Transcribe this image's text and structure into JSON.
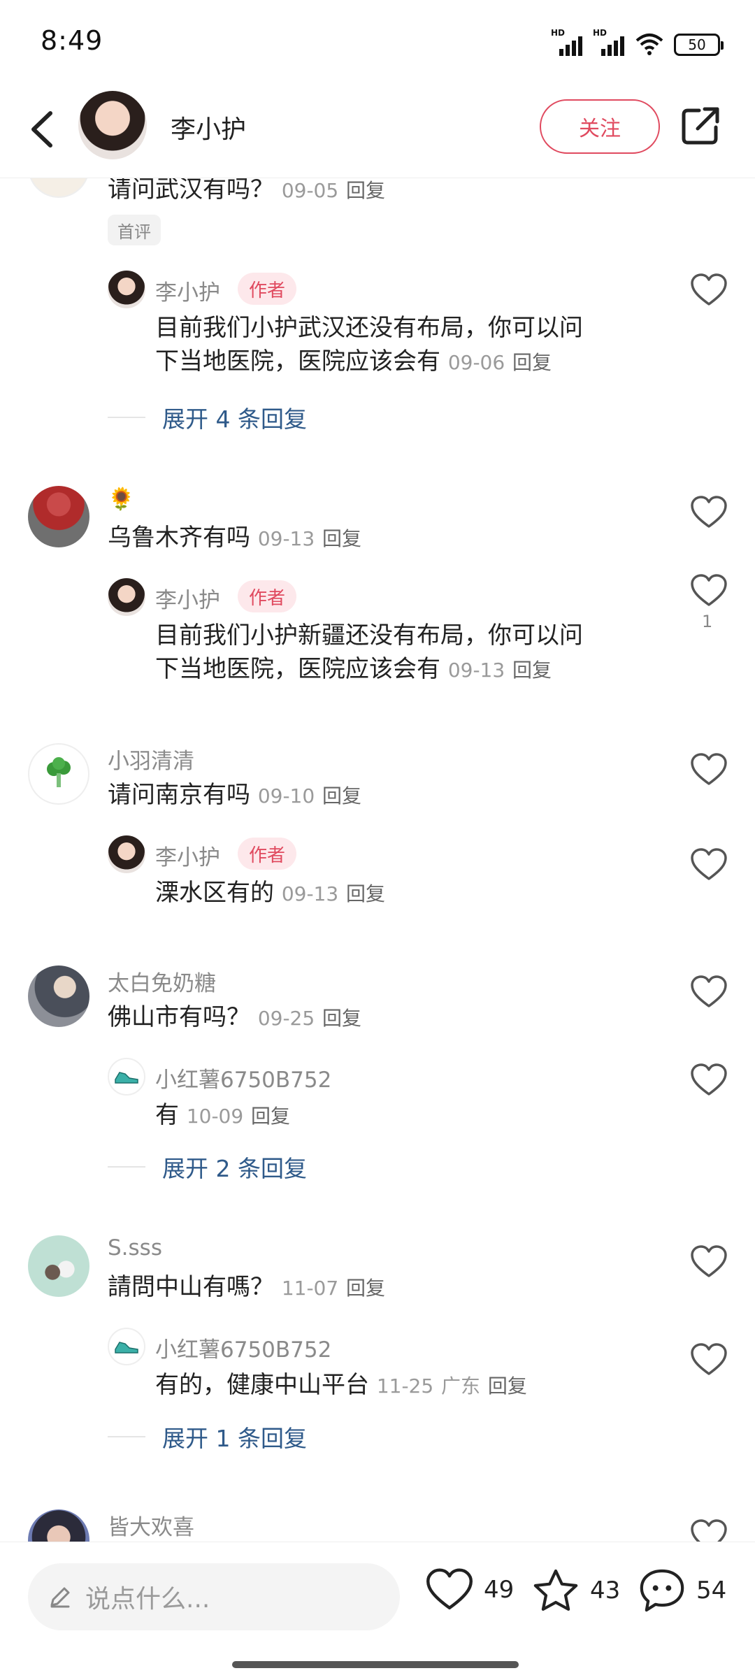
{
  "status_bar": {
    "time": "8:49",
    "battery": "50"
  },
  "header": {
    "username": "李小护",
    "follow_label": "关注"
  },
  "comments": [
    {
      "text": "请问武汉有吗？",
      "date": "09-05",
      "reply_label": "回复",
      "badge": "首评",
      "reply": {
        "name": "李小护",
        "author_tag": "作者",
        "text1": "目前我们小护武汉还没有布局，你可以问",
        "text2": "下当地医院，医院应该会有",
        "date": "09-06",
        "reply_label": "回复"
      },
      "expand": "展开 4 条回复"
    },
    {
      "name_emoji": "🌻",
      "text": "乌鲁木齐有吗",
      "date": "09-13",
      "reply_label": "回复",
      "reply": {
        "name": "李小护",
        "author_tag": "作者",
        "text1": "目前我们小护新疆还没有布局，你可以问",
        "text2": "下当地医院，医院应该会有",
        "date": "09-13",
        "reply_label": "回复",
        "likes": "1"
      }
    },
    {
      "name": "小羽清清",
      "text": "请问南京有吗",
      "date": "09-10",
      "reply_label": "回复",
      "reply": {
        "name": "李小护",
        "author_tag": "作者",
        "text1": "溧水区有的",
        "date": "09-13",
        "reply_label": "回复"
      }
    },
    {
      "name": "太白免奶糖",
      "text": "佛山市有吗？",
      "date": "09-25",
      "reply_label": "回复",
      "reply": {
        "name": "小红薯6750B752",
        "text1": "有",
        "date": "10-09",
        "reply_label": "回复"
      },
      "expand": "展开 2 条回复"
    },
    {
      "name": "S.sss",
      "text": "請問中山有嗎？",
      "date": "11-07",
      "reply_label": "回复",
      "reply": {
        "name": "小红薯6750B752",
        "text1": "有的，健康中山平台",
        "date": "11-25",
        "location": "广东",
        "reply_label": "回复"
      },
      "expand": "展开 1 条回复"
    },
    {
      "name": "皆大欢喜"
    }
  ],
  "bottom_bar": {
    "placeholder": "说点什么...",
    "likes": "49",
    "stars": "43",
    "comments": "54"
  },
  "colors": {
    "accent": "#e04a5f",
    "link": "#2f5a8a"
  }
}
